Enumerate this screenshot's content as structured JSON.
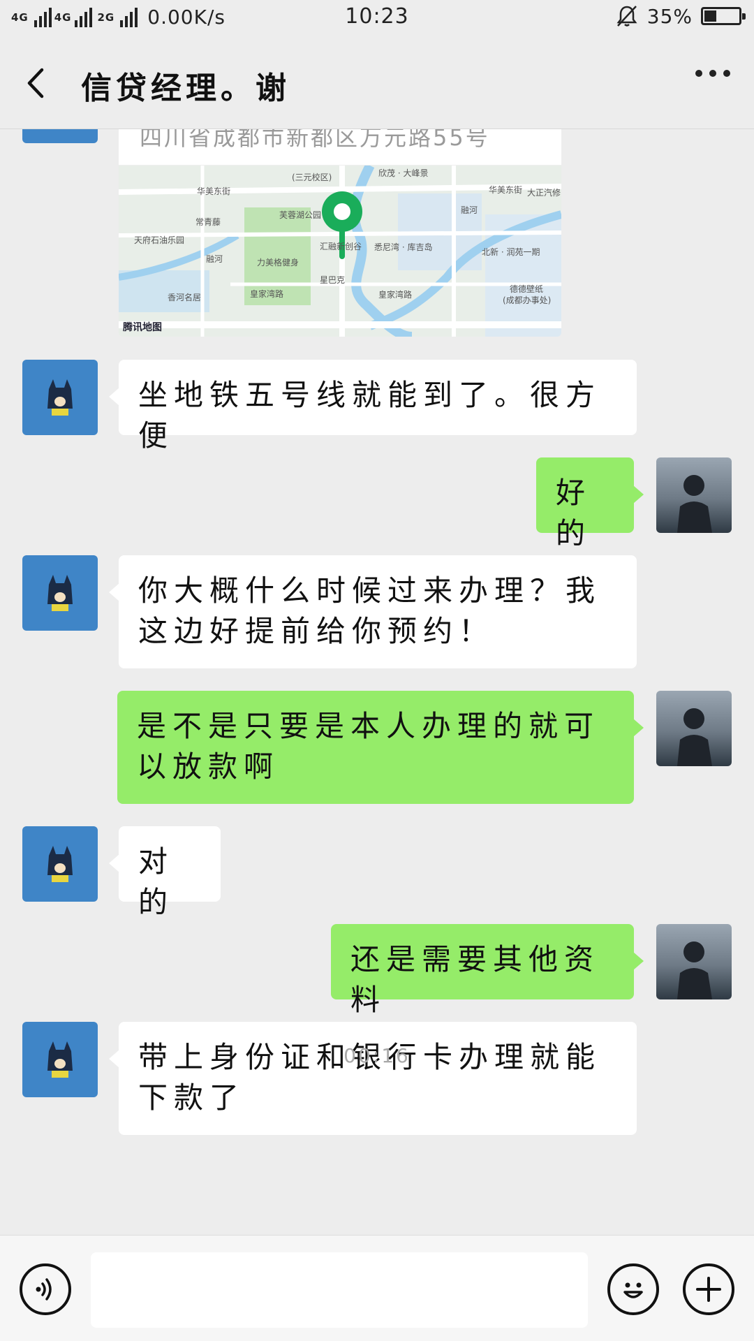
{
  "status_bar": {
    "network_1": "4G",
    "network_2": "4G",
    "network_3": "2G",
    "speed": "0.00K/s",
    "time": "10:23",
    "battery": "35%",
    "battery_level": 0.35
  },
  "header": {
    "title": "信贷经理。谢",
    "back_icon": "chevron-left-icon",
    "more_icon": "more-dots-icon"
  },
  "location": {
    "address": "四川省成都市新都区万元路55号",
    "map_brand": "腾讯地图",
    "map_labels": [
      "(三元校区)",
      "欣茂 · 大峰景",
      "华美东街",
      "华美东街",
      "大正汽修",
      "常青藤",
      "芙蓉湖公园",
      "融河",
      "天府石油乐园",
      "汇融新创谷",
      "悉尼湾 · 库吉岛",
      "北新 · 润苑一期",
      "融河",
      "力美格健身",
      "星巴克",
      "香河名居",
      "皇家湾路",
      "皇家湾路",
      "德德壁纸",
      "(成都办事处)"
    ]
  },
  "messages": [
    {
      "side": "in",
      "text": "坐地铁五号线就能到了。很方便"
    },
    {
      "side": "out",
      "text": "好的"
    },
    {
      "side": "in",
      "text": "你大概什么时候过来办理？我这边好提前给你预约！"
    },
    {
      "side": "out",
      "text": "是不是只要是本人办理的就可以放款啊"
    },
    {
      "side": "in",
      "text": "对的"
    },
    {
      "side": "out",
      "text": "还是需要其他资料"
    },
    {
      "side": "in",
      "text": "带上身份证和银行卡办理就能下款了"
    }
  ],
  "timestamp": "00:16",
  "input_bar": {
    "voice_icon": "voice-icon",
    "emoji_icon": "emoji-icon",
    "plus_icon": "plus-icon",
    "placeholder": ""
  },
  "colors": {
    "background": "#ededed",
    "bubble_in": "#ffffff",
    "bubble_out": "#95ec69",
    "avatar_contact": "#3f85c7",
    "map_pin": "#1aad5a"
  }
}
